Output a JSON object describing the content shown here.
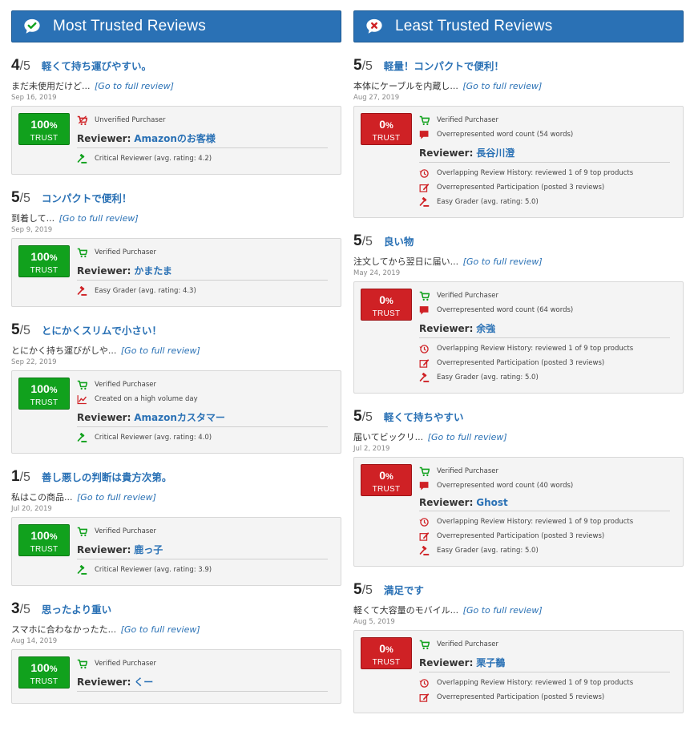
{
  "columns": [
    {
      "title": "Most Trusted Reviews",
      "icon": "check-chat-icon",
      "reviews": [
        {
          "rating": "4",
          "of": "/5",
          "title": "軽くて持ち運びやすい。",
          "snippet": "まだ未使用だけど...",
          "link": "[Go to full review]",
          "date": "Sep 16, 2019",
          "trust": "100",
          "pct_sign": "%",
          "trust_label": "TRUST",
          "flags_top": [
            {
              "icon": "cart-unverified-icon",
              "color": "#cf2125",
              "text": "Unverified Purchaser"
            }
          ],
          "reviewer_label": "Reviewer:",
          "reviewer": "Amazonのお客様",
          "flags_bottom": [
            {
              "icon": "gavel-icon",
              "color": "#11a11d",
              "text": "Critical Reviewer (avg. rating: 4.2)"
            }
          ]
        },
        {
          "rating": "5",
          "of": "/5",
          "title": "コンパクトで便利！",
          "snippet": "到着して...",
          "link": "[Go to full review]",
          "date": "Sep 9, 2019",
          "trust": "100",
          "pct_sign": "%",
          "trust_label": "TRUST",
          "flags_top": [
            {
              "icon": "cart-icon",
              "color": "#11a11d",
              "text": "Verified Purchaser"
            }
          ],
          "reviewer_label": "Reviewer:",
          "reviewer": "かまたま",
          "flags_bottom": [
            {
              "icon": "gavel-icon",
              "color": "#cf2125",
              "text": "Easy Grader (avg. rating: 4.3)"
            }
          ]
        },
        {
          "rating": "5",
          "of": "/5",
          "title": "とにかくスリムで小さい！",
          "snippet": "とにかく持ち運びがしや...",
          "link": "[Go to full review]",
          "date": "Sep 22, 2019",
          "trust": "100",
          "pct_sign": "%",
          "trust_label": "TRUST",
          "flags_top": [
            {
              "icon": "cart-icon",
              "color": "#11a11d",
              "text": "Verified Purchaser"
            },
            {
              "icon": "chart-line-icon",
              "color": "#cf2125",
              "text": "Created on a high volume day"
            }
          ],
          "reviewer_label": "Reviewer:",
          "reviewer": "Amazonカスタマー",
          "flags_bottom": [
            {
              "icon": "gavel-icon",
              "color": "#11a11d",
              "text": "Critical Reviewer (avg. rating: 4.0)"
            }
          ]
        },
        {
          "rating": "1",
          "of": "/5",
          "title": "善し悪しの判断は貴方次第。",
          "snippet": "私はこの商品...",
          "link": "[Go to full review]",
          "date": "Jul 20, 2019",
          "trust": "100",
          "pct_sign": "%",
          "trust_label": "TRUST",
          "flags_top": [
            {
              "icon": "cart-icon",
              "color": "#11a11d",
              "text": "Verified Purchaser"
            }
          ],
          "reviewer_label": "Reviewer:",
          "reviewer": "鹿っ子",
          "flags_bottom": [
            {
              "icon": "gavel-icon",
              "color": "#11a11d",
              "text": "Critical Reviewer (avg. rating: 3.9)"
            }
          ]
        },
        {
          "rating": "3",
          "of": "/5",
          "title": "思ったより重い",
          "snippet": "スマホに合わなかったた...",
          "link": "[Go to full review]",
          "date": "Aug 14, 2019",
          "trust": "100",
          "pct_sign": "%",
          "trust_label": "TRUST",
          "flags_top": [
            {
              "icon": "cart-icon",
              "color": "#11a11d",
              "text": "Verified Purchaser"
            }
          ],
          "reviewer_label": "Reviewer:",
          "reviewer": "くー",
          "flags_bottom": []
        }
      ]
    },
    {
      "title": "Least Trusted Reviews",
      "icon": "x-chat-icon",
      "reviews": [
        {
          "rating": "5",
          "of": "/5",
          "title": "軽量！コンパクトで便利！",
          "snippet": "本体にケーブルを内蔵し...",
          "link": "[Go to full review]",
          "date": "Aug 27, 2019",
          "trust": "0",
          "pct_sign": "%",
          "trust_label": "TRUST",
          "flags_top": [
            {
              "icon": "cart-icon",
              "color": "#11a11d",
              "text": "Verified Purchaser"
            },
            {
              "icon": "comment-icon",
              "color": "#cf2125",
              "text": "Overrepresented word count (54 words)"
            }
          ],
          "reviewer_label": "Reviewer:",
          "reviewer": "長谷川澄",
          "flags_bottom": [
            {
              "icon": "history-icon",
              "color": "#cf2125",
              "text": "Overlapping Review History: reviewed 1 of 9 top products"
            },
            {
              "icon": "edit-icon",
              "color": "#cf2125",
              "text": "Overrepresented Participation (posted 3 reviews)"
            },
            {
              "icon": "gavel-icon",
              "color": "#cf2125",
              "text": "Easy Grader (avg. rating: 5.0)"
            }
          ]
        },
        {
          "rating": "5",
          "of": "/5",
          "title": "良い物",
          "snippet": "注文してから翌日に届い...",
          "link": "[Go to full review]",
          "date": "May 24, 2019",
          "trust": "0",
          "pct_sign": "%",
          "trust_label": "TRUST",
          "flags_top": [
            {
              "icon": "cart-icon",
              "color": "#11a11d",
              "text": "Verified Purchaser"
            },
            {
              "icon": "comment-icon",
              "color": "#cf2125",
              "text": "Overrepresented word count (64 words)"
            }
          ],
          "reviewer_label": "Reviewer:",
          "reviewer": "余強",
          "flags_bottom": [
            {
              "icon": "history-icon",
              "color": "#cf2125",
              "text": "Overlapping Review History: reviewed 1 of 9 top products"
            },
            {
              "icon": "edit-icon",
              "color": "#cf2125",
              "text": "Overrepresented Participation (posted 3 reviews)"
            },
            {
              "icon": "gavel-icon",
              "color": "#cf2125",
              "text": "Easy Grader (avg. rating: 5.0)"
            }
          ]
        },
        {
          "rating": "5",
          "of": "/5",
          "title": "軽くて持ちやすい",
          "snippet": "届いてビックリ...",
          "link": "[Go to full review]",
          "date": "Jul 2, 2019",
          "trust": "0",
          "pct_sign": "%",
          "trust_label": "TRUST",
          "flags_top": [
            {
              "icon": "cart-icon",
              "color": "#11a11d",
              "text": "Verified Purchaser"
            },
            {
              "icon": "comment-icon",
              "color": "#cf2125",
              "text": "Overrepresented word count (40 words)"
            }
          ],
          "reviewer_label": "Reviewer:",
          "reviewer": "Ghost",
          "flags_bottom": [
            {
              "icon": "history-icon",
              "color": "#cf2125",
              "text": "Overlapping Review History: reviewed 1 of 9 top products"
            },
            {
              "icon": "edit-icon",
              "color": "#cf2125",
              "text": "Overrepresented Participation (posted 3 reviews)"
            },
            {
              "icon": "gavel-icon",
              "color": "#cf2125",
              "text": "Easy Grader (avg. rating: 5.0)"
            }
          ]
        },
        {
          "rating": "5",
          "of": "/5",
          "title": "満足です",
          "snippet": "軽くて大容量のモバイル...",
          "link": "[Go to full review]",
          "date": "Aug 5, 2019",
          "trust": "0",
          "pct_sign": "%",
          "trust_label": "TRUST",
          "flags_top": [
            {
              "icon": "cart-icon",
              "color": "#11a11d",
              "text": "Verified Purchaser"
            }
          ],
          "reviewer_label": "Reviewer:",
          "reviewer": "栗子鶺",
          "flags_bottom": [
            {
              "icon": "history-icon",
              "color": "#cf2125",
              "text": "Overlapping Review History: reviewed 1 of 9 top products"
            },
            {
              "icon": "edit-icon",
              "color": "#cf2125",
              "text": "Overrepresented Participation (posted 5 reviews)"
            }
          ]
        }
      ]
    }
  ]
}
